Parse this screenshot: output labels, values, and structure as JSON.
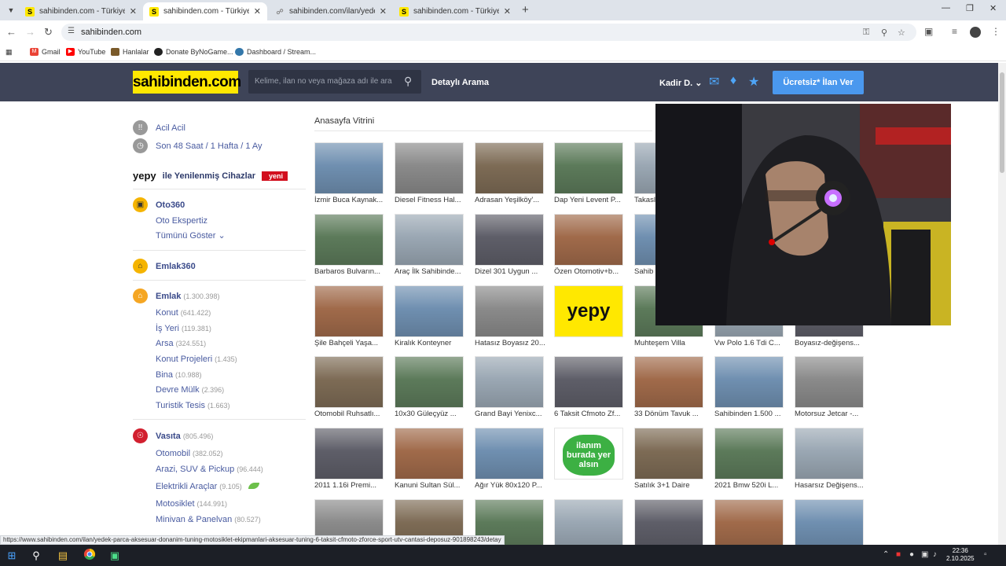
{
  "browser": {
    "tabs": [
      {
        "title": "sahibinden.com - Türkiye'nin Ö",
        "active": false
      },
      {
        "title": "sahibinden.com - Türkiye'nin Ö",
        "active": true
      },
      {
        "title": "sahibinden.com/ilan/yedek-par",
        "active": false
      },
      {
        "title": "sahibinden.com - Türkiye'nin Ö",
        "active": false
      }
    ],
    "url": "sahibinden.com",
    "bookmarks": [
      "Gmail",
      "YouTube",
      "Hanlalar",
      "Donate ByNoGame...",
      "Dashboard / Stream..."
    ]
  },
  "header": {
    "logo": "sahibinden.com",
    "search_placeholder": "Kelime, ilan no veya mağaza adı ile ara",
    "detayli": "Detaylı Arama",
    "user": "Kadir D.",
    "cta": "Ücretsiz* İlan Ver"
  },
  "sidebar": {
    "acil": "Acil Acil",
    "son48": "Son 48 Saat / 1 Hafta / 1 Ay",
    "yepy_logo": "yepy",
    "yepy_text": "ile Yenilenmiş Cihazlar",
    "yepy_badge": "yeni",
    "oto360": "Oto360",
    "oto_ekspertiz": "Oto Ekspertiz",
    "tumunu": "Tümünü Göster",
    "emlak360": "Emlak360",
    "emlak": {
      "label": "Emlak",
      "count": "(1.300.398)"
    },
    "emlak_items": [
      {
        "label": "Konut",
        "count": "(641.422)"
      },
      {
        "label": "İş Yeri",
        "count": "(119.381)"
      },
      {
        "label": "Arsa",
        "count": "(324.551)"
      },
      {
        "label": "Konut Projeleri",
        "count": "(1.435)"
      },
      {
        "label": "Bina",
        "count": "(10.988)"
      },
      {
        "label": "Devre Mülk",
        "count": "(2.396)"
      },
      {
        "label": "Turistik Tesis",
        "count": "(1.663)"
      }
    ],
    "vasita": {
      "label": "Vasıta",
      "count": "(805.496)"
    },
    "vasita_items": [
      {
        "label": "Otomobil",
        "count": "(382.052)"
      },
      {
        "label": "Arazi, SUV & Pickup",
        "count": "(96.444)"
      },
      {
        "label": "Elektrikli Araçlar",
        "count": "(9.105)"
      },
      {
        "label": "Motosiklet",
        "count": "(144.991)"
      },
      {
        "label": "Minivan & Panelvan",
        "count": "(80.527)"
      }
    ]
  },
  "vitrin": {
    "title": "Anasayfa Vitrini",
    "rows": [
      [
        "İzmir Buca Kaynak...",
        "Diesel Fitness Hal...",
        "Adrasan Yeşilköy'...",
        "Dap Yeni Levent P...",
        "Takasl"
      ],
      [
        "Barbaros Bulvarın...",
        "Araç İlk Sahibinde...",
        "Dizel 301 Uygun ...",
        "Özen Otomotiv+b...",
        "Sahib"
      ],
      [
        "Şile Bahçeli Yaşa...",
        "Kiralık Konteyner",
        "Hatasız Boyasız 20...",
        "",
        "Muhteşem Villa",
        "Vw Polo 1.6 Tdi C...",
        "Boyasız-değişens..."
      ],
      [
        "Otomobil Ruhsatlı...",
        "10x30 Güleçyüz ...",
        "Grand Bayi Yenixc...",
        "6 Taksit Cfmoto Zf...",
        "33 Dönüm Tavuk ...",
        "Sahibinden 1.500 ...",
        "Motorsuz Jetcar -..."
      ],
      [
        "2011 1.16i Premi...",
        "Kanuni Sultan Sül...",
        "Ağır Yük 80x120 P...",
        "",
        "Satılık 3+1 Daire",
        "2021 Bmw 520i L...",
        "Hasarsız Değişens..."
      ],
      [
        "",
        "",
        "",
        "",
        "",
        "",
        ""
      ]
    ],
    "yepy_ad": "yepy",
    "ilan_ad": "ilanım burada yer alsın"
  },
  "status_url": "https://www.sahibinden.com/ilan/yedek-parca-aksesuar-donanim-tuning-motosiklet-ekipmanlari-aksesuar-tuning-6-taksit-cfmoto-zforce-sport-utv-cantasi-deposuz-901898243/detay",
  "taskbar": {
    "time": "22:36",
    "date": "2.10.2025"
  }
}
